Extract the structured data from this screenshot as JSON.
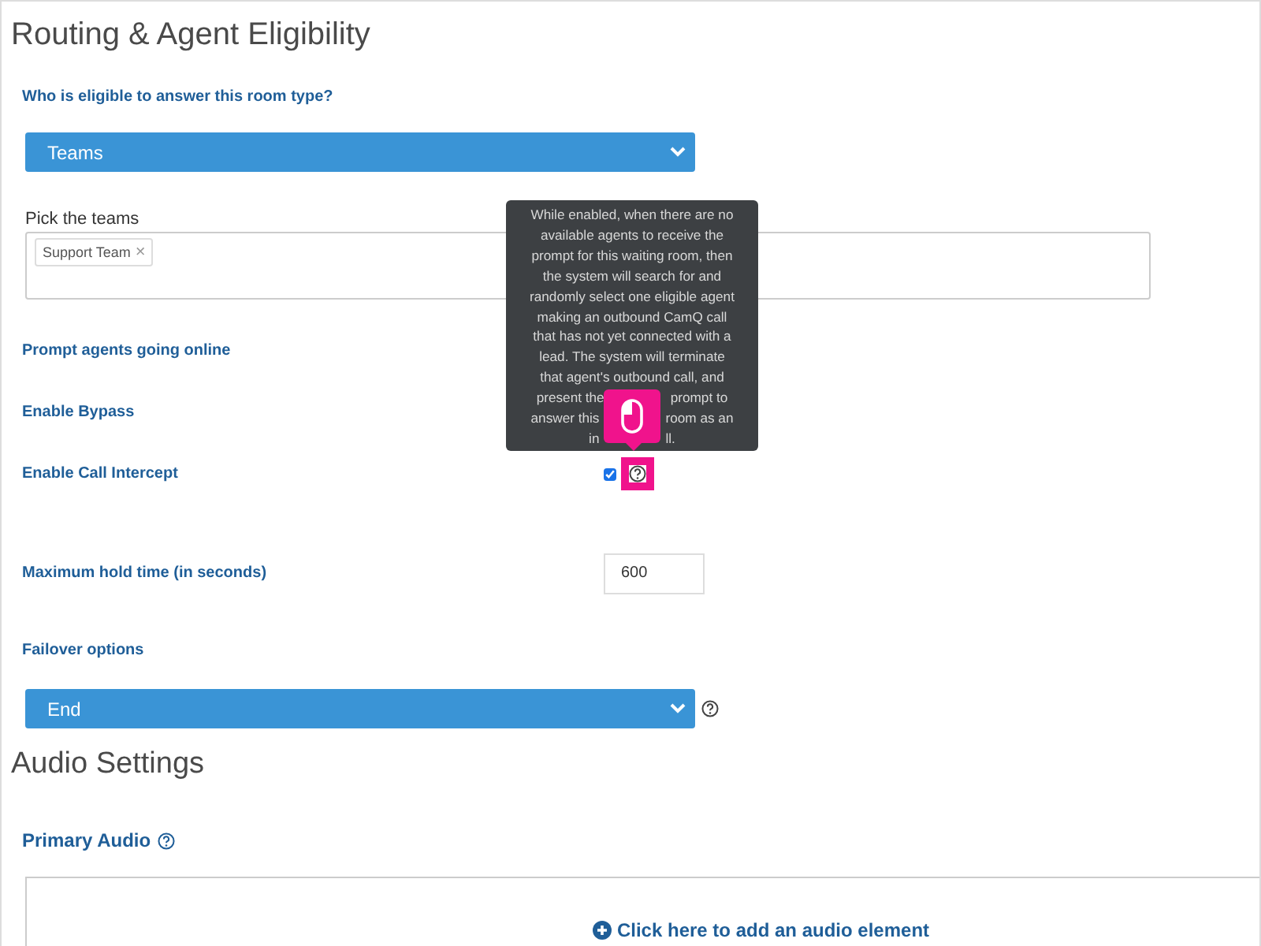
{
  "title": "Routing & Agent Eligibility",
  "eligibility": {
    "label": "Who is eligible to answer this room type?",
    "select": "Teams"
  },
  "teams": {
    "label": "Pick the teams",
    "tags": [
      {
        "label": "Support Team",
        "remove": "×"
      }
    ]
  },
  "settings": [
    {
      "kind": "label",
      "label": "Prompt agents going online"
    },
    {
      "kind": "label",
      "label": "Enable Bypass"
    },
    {
      "kind": "checkbox",
      "label": "Enable Call Intercept",
      "checked": true
    },
    {
      "kind": "number",
      "label": "Maximum hold time (in seconds)",
      "value": "600"
    }
  ],
  "failover": {
    "label": "Failover options",
    "select": "End"
  },
  "tooltip": {
    "lines": [
      [
        "While enabled, when there are no"
      ],
      [
        "available agents to receive the"
      ],
      [
        "prompt for this waiting room, then"
      ],
      [
        "the system will search for and"
      ],
      [
        "randomly select one eligible agent"
      ],
      [
        "making an outbound CamQ call"
      ],
      [
        "that has not yet connected with a"
      ],
      [
        "lead. The system will terminate"
      ],
      [
        "that agent's outbound call, and"
      ],
      [
        "present the",
        "prompt to"
      ],
      [
        "answer this",
        "room as an"
      ],
      [
        "in",
        "ll."
      ]
    ]
  },
  "audio": {
    "title": "Audio Settings",
    "primary_label": "Primary Audio",
    "add_link": "Click here to add an audio element"
  }
}
